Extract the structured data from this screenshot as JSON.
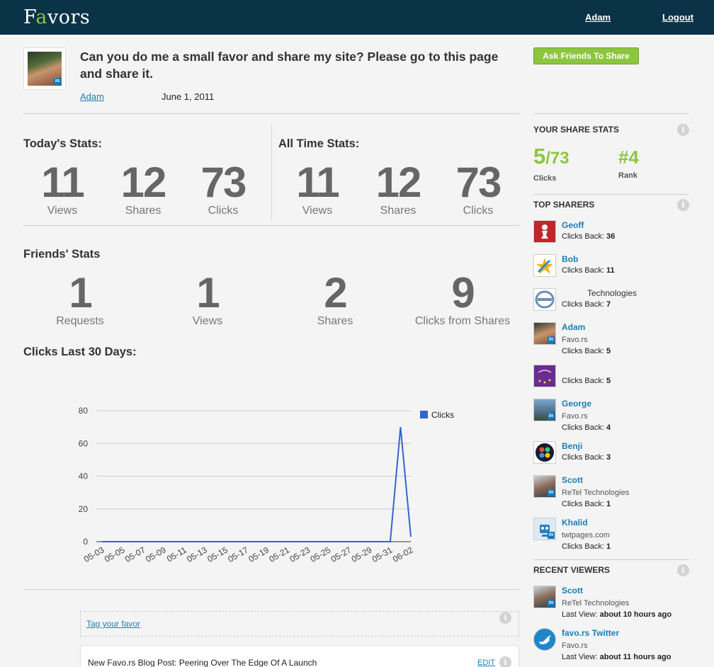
{
  "header": {
    "logo_prefix": "F",
    "logo_accent": "a",
    "logo_suffix": "vors",
    "user_link": "Adam",
    "logout_link": "Logout"
  },
  "favor": {
    "title": "Can you do me a small favor and share my site? Please go to this page and share it.",
    "author": "Adam",
    "date": "June 1, 2011",
    "ask_button": "Ask Friends To Share"
  },
  "today_stats": {
    "title": "Today's Stats:",
    "items": [
      {
        "value": "11",
        "label": "Views"
      },
      {
        "value": "12",
        "label": "Shares"
      },
      {
        "value": "73",
        "label": "Clicks"
      }
    ]
  },
  "all_time_stats": {
    "title": "All Time Stats:",
    "items": [
      {
        "value": "11",
        "label": "Views"
      },
      {
        "value": "12",
        "label": "Shares"
      },
      {
        "value": "73",
        "label": "Clicks"
      }
    ]
  },
  "friends_stats": {
    "title": "Friends' Stats",
    "items": [
      {
        "value": "1",
        "label": "Requests"
      },
      {
        "value": "1",
        "label": "Views"
      },
      {
        "value": "2",
        "label": "Shares"
      },
      {
        "value": "9",
        "label": "Clicks from Shares"
      }
    ]
  },
  "chart_title": "Clicks Last 30 Days:",
  "chart_data": {
    "type": "line",
    "title": "",
    "xlabel": "",
    "ylabel": "",
    "ylim": [
      0,
      80
    ],
    "yticks": [
      0,
      20,
      40,
      60,
      80
    ],
    "legend": "top-right",
    "x": [
      "05-03",
      "05-04",
      "05-05",
      "05-06",
      "05-07",
      "05-08",
      "05-09",
      "05-10",
      "05-11",
      "05-12",
      "05-13",
      "05-14",
      "05-15",
      "05-16",
      "05-17",
      "05-18",
      "05-19",
      "05-20",
      "05-21",
      "05-22",
      "05-23",
      "05-24",
      "05-25",
      "05-26",
      "05-27",
      "05-28",
      "05-29",
      "05-30",
      "05-31",
      "06-01",
      "06-02"
    ],
    "xtick_labels": [
      "05-03",
      "05-05",
      "05-07",
      "05-09",
      "05-11",
      "05-13",
      "05-15",
      "05-17",
      "05-19",
      "05-21",
      "05-23",
      "05-25",
      "05-27",
      "05-29",
      "05-31",
      "06-02"
    ],
    "series": [
      {
        "name": "Clicks",
        "color": "#3366cc",
        "values": [
          0,
          0,
          0,
          0,
          0,
          0,
          0,
          0,
          0,
          0,
          0,
          0,
          0,
          0,
          0,
          0,
          0,
          0,
          0,
          0,
          0,
          0,
          0,
          0,
          0,
          0,
          0,
          0,
          0,
          70,
          3
        ]
      }
    ]
  },
  "sidebar": {
    "share_stats_title": "YOUR SHARE STATS",
    "clicks_value": "5",
    "clicks_total": "/73",
    "clicks_label": "Clicks",
    "rank_value": "#4",
    "rank_label": "Rank",
    "top_sharers_title": "TOP SHARERS",
    "top_sharers": [
      {
        "name": "Geoff",
        "org": "",
        "clicks": "36"
      },
      {
        "name": "Bob",
        "org": "",
        "clicks": "11"
      },
      {
        "name": "Technologies",
        "org": "",
        "clicks": "7"
      },
      {
        "name": "Adam",
        "org": "Favo.rs",
        "clicks": "5"
      },
      {
        "name": "",
        "org": "",
        "clicks": "5"
      },
      {
        "name": "George",
        "org": "Favo.rs",
        "clicks": "4"
      },
      {
        "name": "Benji",
        "org": "",
        "clicks": "3"
      },
      {
        "name": "Scott",
        "org": "ReTel Technologies",
        "clicks": "1"
      },
      {
        "name": "Khalid",
        "org": "twtpages.com",
        "clicks": "1"
      }
    ],
    "clicks_back_label": "Clicks Back:",
    "recent_viewers_title": "RECENT VIEWERS",
    "recent_viewers": [
      {
        "name": "Scott",
        "org": "ReTel Technologies",
        "last_view": "about 10 hours ago"
      },
      {
        "name": "favo.rs Twitter",
        "org": "Favo.rs",
        "last_view": "about 11 hours ago"
      }
    ],
    "last_view_label": "Last View:"
  },
  "tag": {
    "link": "Tag your favor"
  },
  "post": {
    "text": "New Favo.rs Blog Post: Peering Over The Edge Of A Launch",
    "edit": "EDIT"
  },
  "colors": {
    "brand_dark": "#0b3347",
    "accent_green": "#8cc63f",
    "link_blue": "#1b7fb5",
    "line_blue": "#3366cc"
  }
}
